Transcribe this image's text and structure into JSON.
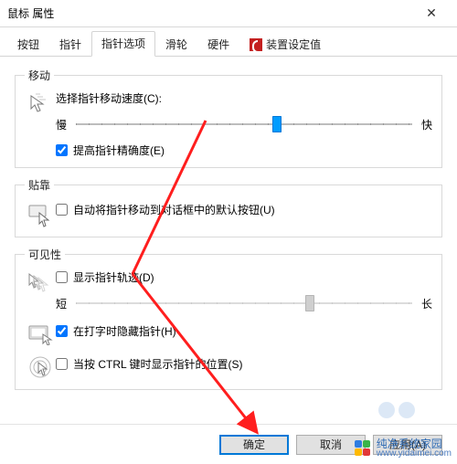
{
  "window": {
    "title": "鼠标 属性"
  },
  "tabs": [
    {
      "label": "按钮"
    },
    {
      "label": "指针"
    },
    {
      "label": "指针选项"
    },
    {
      "label": "滑轮"
    },
    {
      "label": "硬件"
    },
    {
      "label": "装置设定值"
    }
  ],
  "active_tab": 2,
  "motion": {
    "legend": "移动",
    "speed_label": "选择指针移动速度(C):",
    "slow": "慢",
    "fast": "快",
    "speed_value": 6,
    "speed_min": 0,
    "speed_max": 10,
    "precision_label": "提高指针精确度(E)",
    "precision_checked": true
  },
  "snap": {
    "legend": "贴靠",
    "label": "自动将指针移动到对话框中的默认按钮(U)",
    "checked": false
  },
  "visibility": {
    "legend": "可见性",
    "trails_label": "显示指针轨迹(D)",
    "trails_checked": false,
    "short": "短",
    "long": "长",
    "trails_value": 7,
    "trails_min": 0,
    "trails_max": 10,
    "hide_typing_label": "在打字时隐藏指针(H)",
    "hide_typing_checked": true,
    "ctrl_locate_label": "当按 CTRL 键时显示指针的位置(S)",
    "ctrl_locate_checked": false
  },
  "buttons": {
    "ok": "确定",
    "cancel": "取消",
    "apply": "应用(A)"
  },
  "watermark": {
    "brand": "纯净系统家园",
    "url": "www.yidaimei.com"
  }
}
